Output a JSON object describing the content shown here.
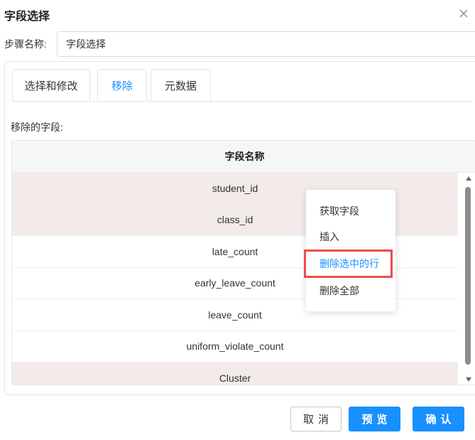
{
  "dialog": {
    "title": "字段选择"
  },
  "step": {
    "label": "步骤名称:",
    "value": "字段选择"
  },
  "tabs": [
    {
      "label": "选择和修改",
      "active": false
    },
    {
      "label": "移除",
      "active": true
    },
    {
      "label": "元数据",
      "active": false
    }
  ],
  "removed": {
    "label": "移除的字段:",
    "column_header": "字段名称",
    "rows": [
      {
        "name": "student_id",
        "selected": true
      },
      {
        "name": "class_id",
        "selected": true
      },
      {
        "name": "late_count",
        "selected": false
      },
      {
        "name": "early_leave_count",
        "selected": false
      },
      {
        "name": "leave_count",
        "selected": false
      },
      {
        "name": "uniform_violate_count",
        "selected": false
      },
      {
        "name": "Cluster",
        "selected": true
      }
    ]
  },
  "context_menu": {
    "items": [
      {
        "label": "获取字段",
        "highlighted": false
      },
      {
        "label": "插入",
        "highlighted": false
      },
      {
        "label": "删除选中的行",
        "highlighted": true
      },
      {
        "label": "删除全部",
        "highlighted": false
      }
    ]
  },
  "footer": {
    "cancel_label": "取消",
    "preview_label": "预览",
    "confirm_label": "确认"
  },
  "colors": {
    "accent": "#1890ff",
    "selected_row": "#f3eaea",
    "annotation_box": "#ef4b4b"
  }
}
